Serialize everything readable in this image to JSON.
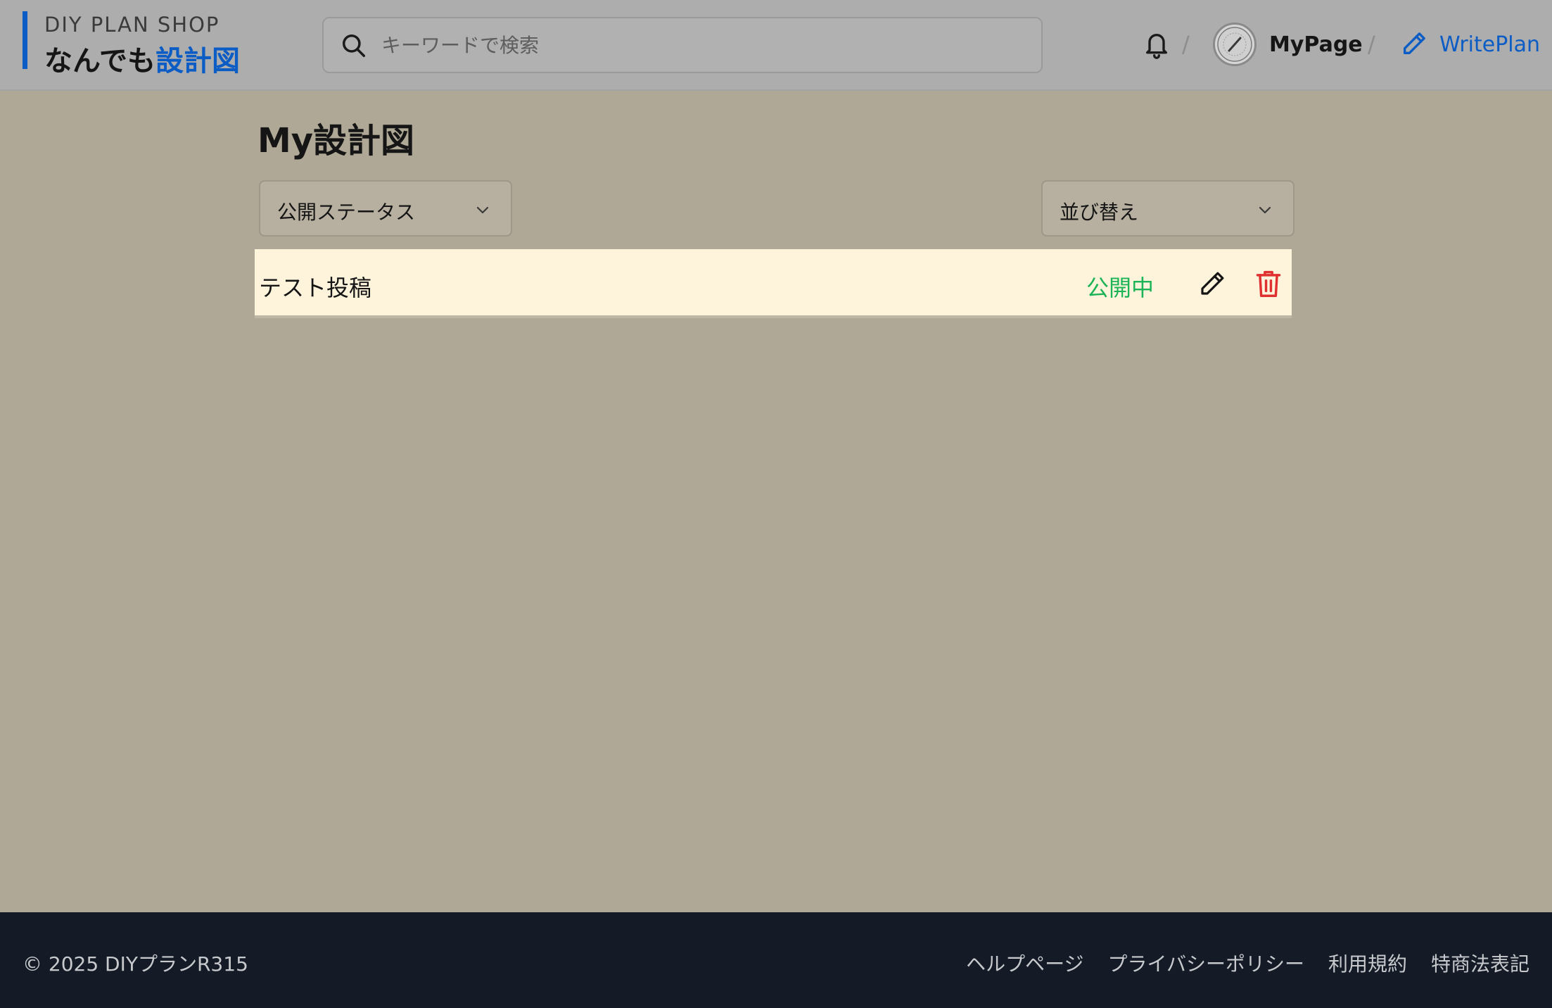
{
  "header": {
    "logo_top": "DIY PLAN SHOP",
    "logo_main": "なんでも",
    "logo_accent": "設計図",
    "search_placeholder": "キーワードで検索",
    "separator": "/",
    "mypage_label": "MyPage",
    "writeplan_label": "WritePlan"
  },
  "main": {
    "title": "My設計図",
    "filter_status_label": "公開ステータス",
    "sort_label": "並び替え",
    "plans": [
      {
        "title": "テスト投稿",
        "status": "公開中"
      }
    ]
  },
  "footer": {
    "copyright": "© 2025 DIYプランR315",
    "links": [
      "ヘルプページ",
      "プライバシーポリシー",
      "利用規約",
      "特商法表記"
    ]
  },
  "colors": {
    "accent": "#0b5cc4",
    "status_public": "#1cb456",
    "delete": "#e03131",
    "row_background": "#fef4dc",
    "page_background": "#afa896"
  },
  "icons": [
    "search-icon",
    "bell-icon",
    "avatar",
    "pencil-icon",
    "chevron-down-icon",
    "trash-icon"
  ]
}
